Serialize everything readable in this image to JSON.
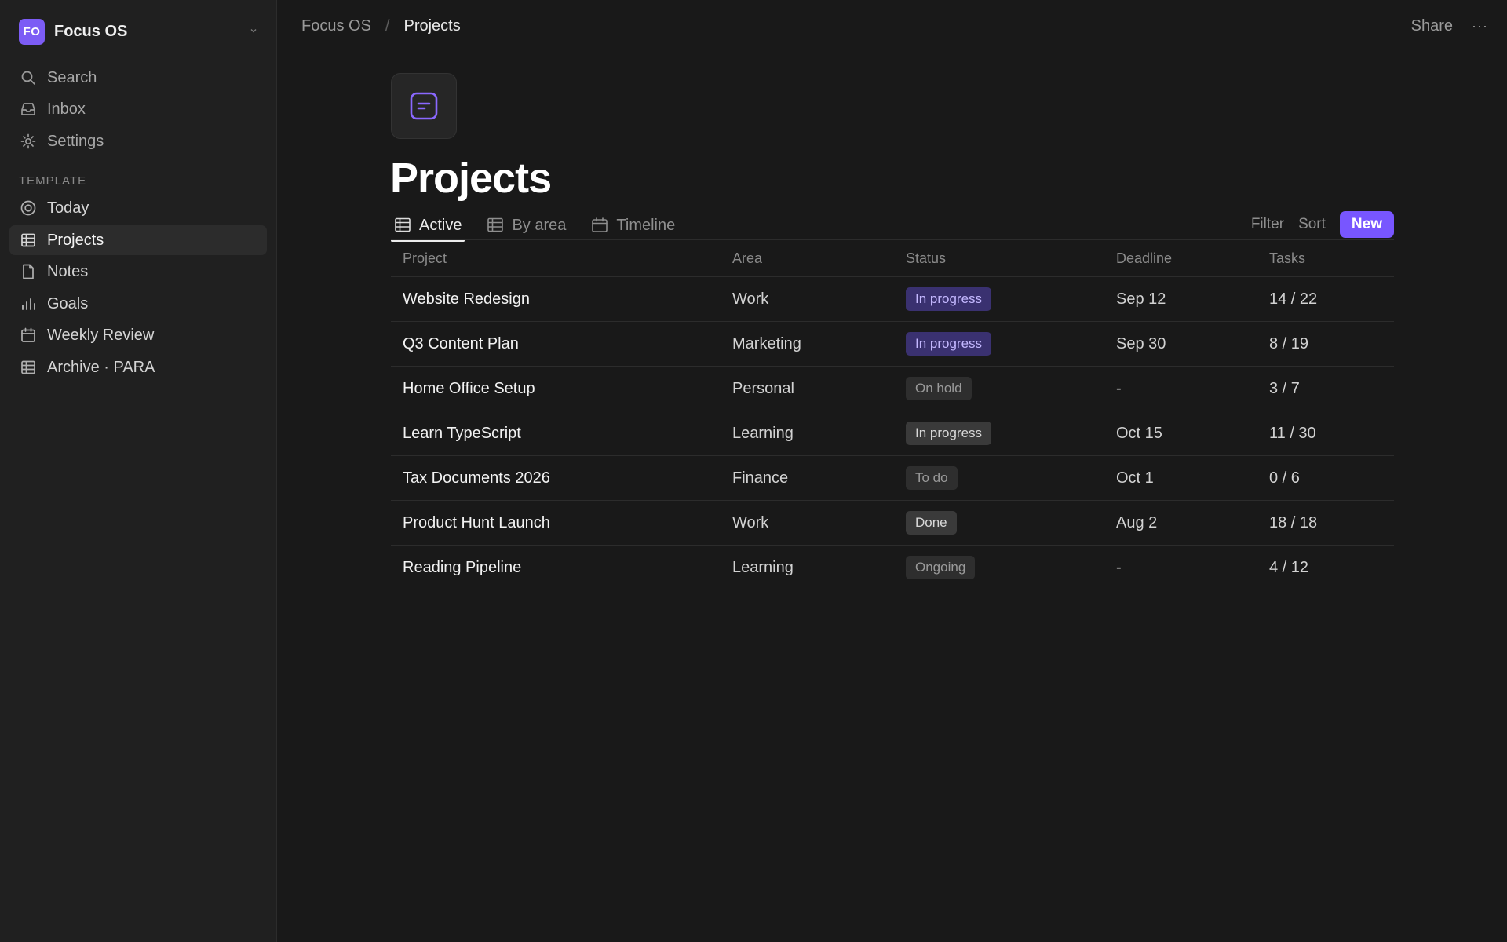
{
  "workspace": {
    "badge": "FO",
    "name": "Focus OS"
  },
  "sidebar": {
    "top_items": [
      {
        "label": "Search",
        "icon": "search-icon"
      },
      {
        "label": "Inbox",
        "icon": "inbox-icon"
      },
      {
        "label": "Settings",
        "icon": "gear-icon"
      }
    ],
    "section_label": "TEMPLATE",
    "template_items": [
      {
        "label": "Today",
        "icon": "target-icon"
      },
      {
        "label": "Projects",
        "icon": "table-icon",
        "selected": true
      },
      {
        "label": "Notes",
        "icon": "document-icon"
      },
      {
        "label": "Goals",
        "icon": "bar-chart-icon"
      },
      {
        "label": "Weekly Review",
        "icon": "calendar-icon"
      },
      {
        "label": "Archive · PARA",
        "icon": "table-icon"
      }
    ]
  },
  "breadcrumb": {
    "root": "Focus OS",
    "separator": "/",
    "current": "Projects"
  },
  "top_actions": {
    "share": "Share",
    "more": "···"
  },
  "page": {
    "title": "Projects",
    "icon": "note-icon"
  },
  "tabs": [
    {
      "label": "Active",
      "icon": "table-icon",
      "active": true
    },
    {
      "label": "By area",
      "icon": "table-icon",
      "active": false
    },
    {
      "label": "Timeline",
      "icon": "calendar-icon",
      "active": false
    }
  ],
  "view_actions": {
    "filter": "Filter",
    "sort": "Sort",
    "new": "New"
  },
  "table": {
    "columns": [
      "Project",
      "Area",
      "Status",
      "Deadline",
      "Tasks"
    ],
    "rows": [
      {
        "project": "Website Redesign",
        "area": "Work",
        "status": "In progress",
        "status_type": "progress",
        "deadline": "Sep 12",
        "tasks": "14 / 22"
      },
      {
        "project": "Q3 Content Plan",
        "area": "Marketing",
        "status": "In progress",
        "status_type": "progress",
        "deadline": "Sep 30",
        "tasks": "8 / 19"
      },
      {
        "project": "Home Office Setup",
        "area": "Personal",
        "status": "On hold",
        "status_type": "muted",
        "deadline": "-",
        "tasks": "3 / 7"
      },
      {
        "project": "Learn TypeScript",
        "area": "Learning",
        "status": "In progress",
        "status_type": "neutral",
        "deadline": "Oct 15",
        "tasks": "11 / 30"
      },
      {
        "project": "Tax Documents 2026",
        "area": "Finance",
        "status": "To do",
        "status_type": "muted",
        "deadline": "Oct 1",
        "tasks": "0 / 6"
      },
      {
        "project": "Product Hunt Launch",
        "area": "Work",
        "status": "Done",
        "status_type": "done",
        "deadline": "Aug 2",
        "tasks": "18 / 18"
      },
      {
        "project": "Reading Pipeline",
        "area": "Learning",
        "status": "Ongoing",
        "status_type": "muted",
        "deadline": "-",
        "tasks": "4 / 12"
      }
    ]
  },
  "colors": {
    "accent": "#7856ff",
    "status_progress_bg": "#3a3170",
    "status_progress_fg": "#c4b8ff",
    "status_neutral_bg": "#3a3a3a",
    "status_neutral_fg": "#d8d8d8",
    "status_muted_bg": "#2e2e2e",
    "status_muted_fg": "#9a9a9a"
  }
}
